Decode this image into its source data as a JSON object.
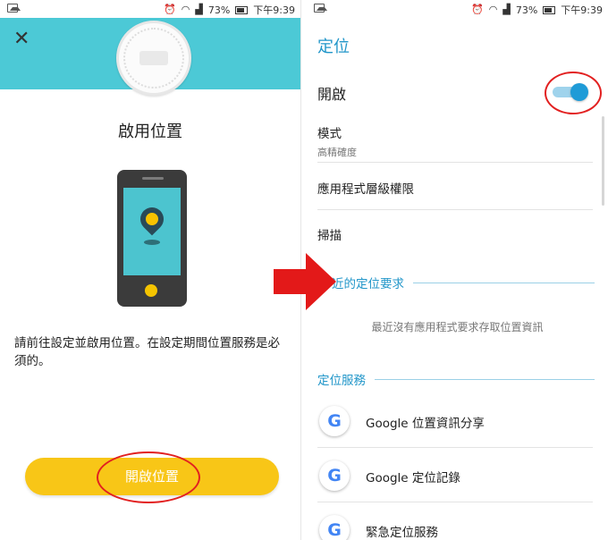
{
  "statusbar": {
    "battery": "73%",
    "time": "下午9:39"
  },
  "left": {
    "title": "啟用位置",
    "description": "請前往設定並啟用位置。在設定期間位置服務是必須的。",
    "button": "開啟位置"
  },
  "right": {
    "title": "定位",
    "switch_label": "開啟",
    "switch_on": true,
    "mode_label": "模式",
    "mode_value": "高精確度",
    "app_permissions": "應用程式層級權限",
    "scan": "掃描",
    "recent_header": "近的定位要求",
    "no_recent": "最近沒有應用程式要求存取位置資訊",
    "services_header": "定位服務",
    "services": [
      "Google 位置資訊分享",
      "Google 定位記錄",
      "緊急定位服務"
    ]
  },
  "colors": {
    "teal": "#4cc9d6",
    "accent": "#2196c9",
    "yellow": "#f8c617",
    "red": "#e22020"
  },
  "icons": [
    "close-icon",
    "google-icon",
    "red-arrow-icon",
    "location-pin-icon"
  ]
}
